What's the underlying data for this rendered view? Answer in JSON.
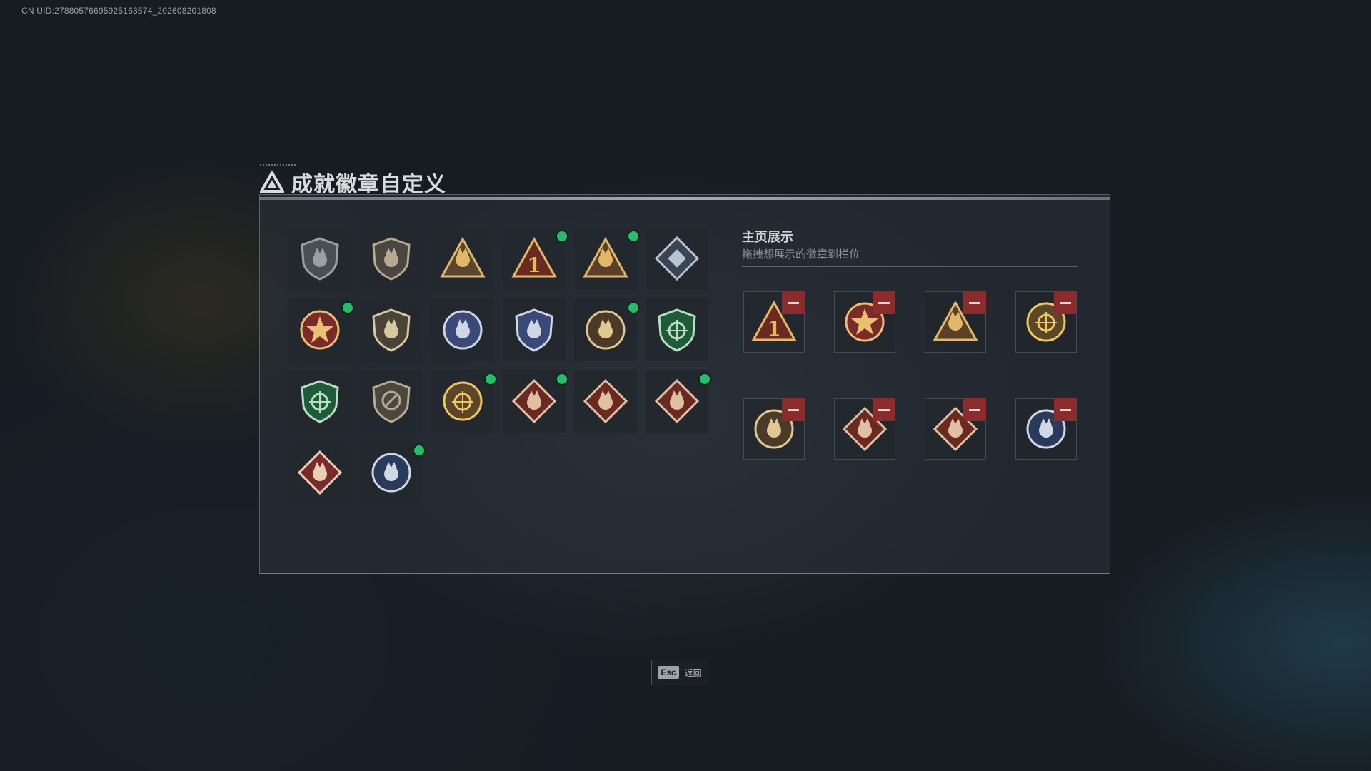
{
  "uid_text": "CN UID:27880576695925163574_202608201808",
  "title": {
    "icon": "triangle-logo-icon",
    "text": "成就徽章自定义"
  },
  "badge_grid": [
    {
      "icon": "shield-triangle-badge-icon",
      "new": false,
      "palette": [
        "#4a4f56",
        "#9aa0a6"
      ]
    },
    {
      "icon": "helicopter-shield-badge-icon",
      "new": false,
      "palette": [
        "#4a4640",
        "#b7aa90"
      ]
    },
    {
      "icon": "bird-triangle-badge-icon",
      "new": false,
      "palette": [
        "#5a4630",
        "#e2b868"
      ]
    },
    {
      "icon": "number-one-triangle-badge-icon",
      "new": true,
      "palette": [
        "#6a2a22",
        "#e8b860"
      ]
    },
    {
      "icon": "soldiers-triangle-badge-icon",
      "new": true,
      "palette": [
        "#5a4028",
        "#e2b868"
      ]
    },
    {
      "icon": "crystal-diamond-badge-icon",
      "new": false,
      "palette": [
        "#3a4452",
        "#b8c4d4"
      ]
    },
    {
      "icon": "star-wreath-badge-icon",
      "new": true,
      "palette": [
        "#7a2a2a",
        "#e8c070"
      ]
    },
    {
      "icon": "eagle-shield-badge-icon",
      "new": false,
      "palette": [
        "#4a4438",
        "#d8c8a0"
      ]
    },
    {
      "icon": "blue-police-badge-icon",
      "new": false,
      "palette": [
        "#3a4a78",
        "#d0d6e4"
      ]
    },
    {
      "icon": "blue-wolf-badge-icon",
      "new": false,
      "palette": [
        "#3a4a78",
        "#d0d6e4"
      ]
    },
    {
      "icon": "skull-round-badge-icon",
      "new": true,
      "palette": [
        "#4a3a28",
        "#e0c890"
      ]
    },
    {
      "icon": "green-crosshair-shield-badge-icon",
      "new": false,
      "palette": [
        "#1f5a3a",
        "#b8e0c0"
      ]
    },
    {
      "icon": "green-rifle-shield-badge-icon",
      "new": false,
      "palette": [
        "#1f5a3a",
        "#b8e0c0"
      ]
    },
    {
      "icon": "no-sign-shield-badge-icon",
      "new": false,
      "palette": [
        "#4a4640",
        "#b7aa90"
      ]
    },
    {
      "icon": "gold-crosshair-crest-badge-icon",
      "new": true,
      "palette": [
        "#5a4628",
        "#f0c860"
      ]
    },
    {
      "icon": "dragon-diamond-badge-icon",
      "new": true,
      "palette": [
        "#6a2a22",
        "#e0c0a0"
      ]
    },
    {
      "icon": "dragon-diamond-badge-icon",
      "new": false,
      "palette": [
        "#6a2a22",
        "#e0c0a0"
      ]
    },
    {
      "icon": "dragon-diamond-badge-icon",
      "new": true,
      "palette": [
        "#6a2a22",
        "#e0c0a0"
      ]
    },
    {
      "icon": "runner-diamond-badge-icon",
      "new": false,
      "palette": [
        "#7a2a2a",
        "#e8d0b8"
      ]
    },
    {
      "icon": "wolf-round-badge-icon",
      "new": true,
      "palette": [
        "#2a3a5a",
        "#d0d8e4"
      ]
    }
  ],
  "showcase": {
    "title": "主页展示",
    "subtitle": "拖拽想展示的徽章到栏位",
    "slots": [
      {
        "icon": "number-one-triangle-badge-icon",
        "palette": [
          "#6a2a22",
          "#e8b860"
        ]
      },
      {
        "icon": "star-wreath-badge-icon",
        "palette": [
          "#7a2a2a",
          "#e8c070"
        ]
      },
      {
        "icon": "soldiers-triangle-badge-icon",
        "palette": [
          "#5a4028",
          "#e2b868"
        ]
      },
      {
        "icon": "gold-crosshair-crest-badge-icon",
        "palette": [
          "#5a4628",
          "#f0c860"
        ]
      },
      {
        "icon": "skull-round-badge-icon",
        "palette": [
          "#4a3a28",
          "#e0c890"
        ]
      },
      {
        "icon": "dragon-diamond-badge-icon",
        "palette": [
          "#6a2a22",
          "#e0c0a0"
        ]
      },
      {
        "icon": "dragon-diamond-badge-icon",
        "palette": [
          "#6a2a22",
          "#e0c0a0"
        ]
      },
      {
        "icon": "wolf-round-badge-icon",
        "palette": [
          "#2a3a5a",
          "#d0d8e4"
        ]
      }
    ],
    "remove_icon": "minus-icon"
  },
  "footer": {
    "esc_key": "Esc",
    "esc_label": "返回"
  }
}
